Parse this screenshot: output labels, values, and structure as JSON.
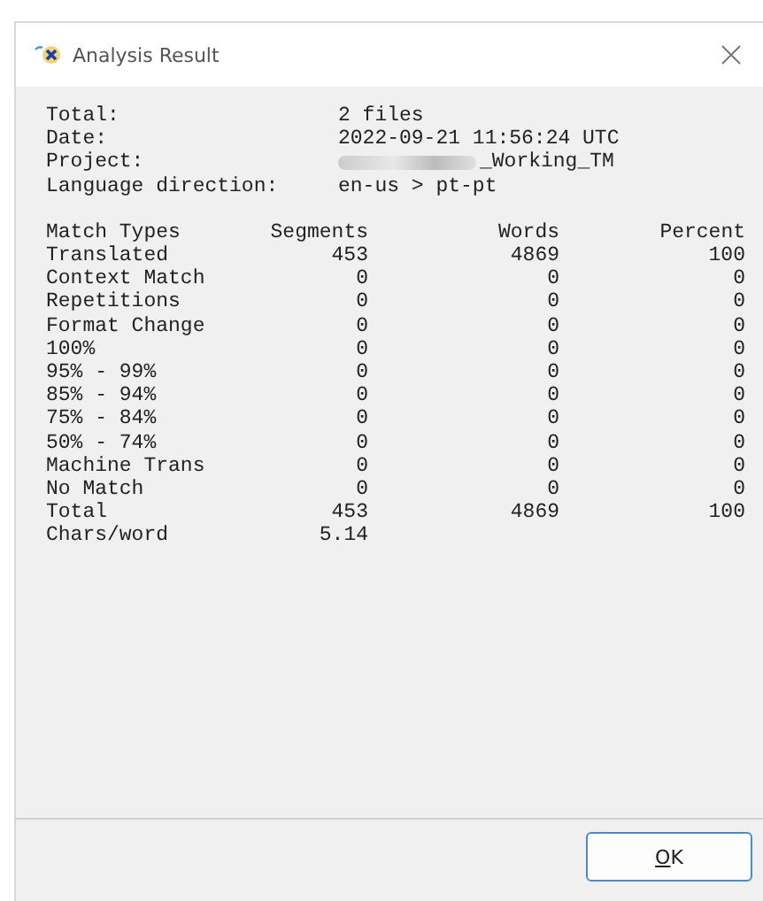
{
  "window": {
    "title": "Analysis Result"
  },
  "summary": [
    {
      "label": "Total:",
      "value": "2 files",
      "redacted": false
    },
    {
      "label": "Date:",
      "value": "2022-09-21 11:56:24 UTC",
      "redacted": false
    },
    {
      "label": "Project:",
      "value": "_Working_TM",
      "redacted": true
    },
    {
      "label": "Language direction:",
      "value": "en-us > pt-pt",
      "redacted": false
    }
  ],
  "table": {
    "columns": [
      "Match Types",
      "Segments",
      "Words",
      "Percent"
    ],
    "rows": [
      [
        "Translated",
        "453",
        "4869",
        "100"
      ],
      [
        "Context Match",
        "0",
        "0",
        "0"
      ],
      [
        "Repetitions",
        "0",
        "0",
        "0"
      ],
      [
        "Format Change",
        "0",
        "0",
        "0"
      ],
      [
        "100%",
        "0",
        "0",
        "0"
      ],
      [
        "95% - 99%",
        "0",
        "0",
        "0"
      ],
      [
        "85% - 94%",
        "0",
        "0",
        "0"
      ],
      [
        "75% - 84%",
        "0",
        "0",
        "0"
      ],
      [
        "50% - 74%",
        "0",
        "0",
        "0"
      ],
      [
        "Machine Trans",
        "0",
        "0",
        "0"
      ],
      [
        "No Match",
        "0",
        "0",
        "0"
      ],
      [
        "Total",
        "453",
        "4869",
        "100"
      ],
      [
        "Chars/word",
        "5.14"
      ]
    ]
  },
  "buttons": [
    {
      "label": "OK"
    }
  ]
}
